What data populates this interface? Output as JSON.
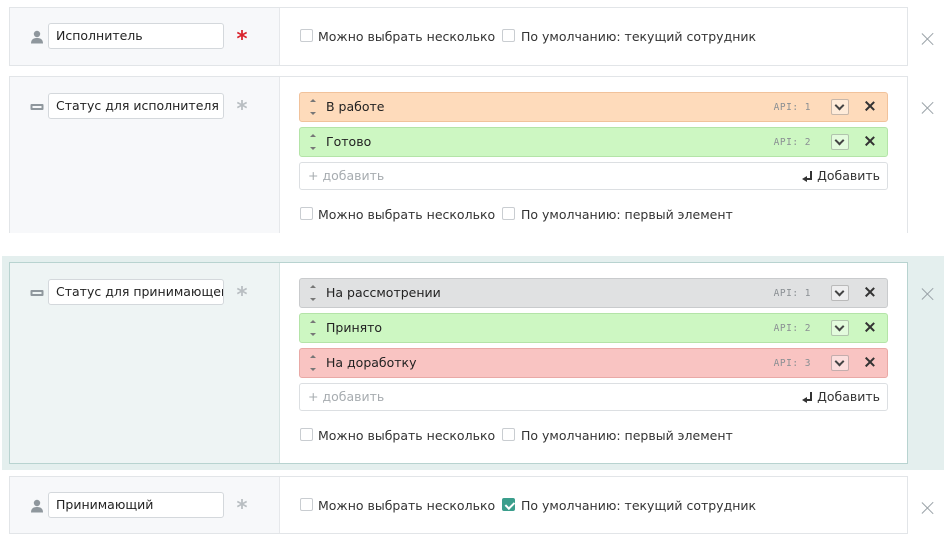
{
  "fields": [
    {
      "name": "Исполнитель",
      "icon": "user-icon",
      "required": true,
      "multiple_label": "Можно выбрать несколько",
      "default_label": "По умолчанию: текущий сотрудник",
      "default_checked": false
    },
    {
      "name": "Статус для исполнителя",
      "icon": "list-type-icon",
      "required": false,
      "options": [
        {
          "label": "В работе",
          "api": "API: 1",
          "color": "#fedbbb"
        },
        {
          "label": "Готово",
          "api": "API: 2",
          "color": "#cdf7c2"
        }
      ],
      "add_placeholder": "+ добавить",
      "add_button": "Добавить",
      "multiple_label": "Можно выбрать несколько",
      "default_label": "По умолчанию: первый элемент"
    },
    {
      "name": "Статус для принимающего",
      "icon": "list-type-icon",
      "required": false,
      "options": [
        {
          "label": "На рассмотрении",
          "api": "API: 1",
          "color": "#e0e1e2"
        },
        {
          "label": "Принято",
          "api": "API: 2",
          "color": "#cdf7c2"
        },
        {
          "label": "На доработку",
          "api": "API: 3",
          "color": "#f9c4c2"
        }
      ],
      "add_placeholder": "+ добавить",
      "add_button": "Добавить",
      "multiple_label": "Можно выбрать несколько",
      "default_label": "По умолчанию: первый элемент"
    },
    {
      "name": "Принимающий",
      "icon": "user-icon",
      "required": false,
      "multiple_label": "Можно выбрать несколько",
      "default_label": "По умолчанию: текущий сотрудник",
      "default_checked": true
    }
  ],
  "colors": {
    "accent": "#3b9e8c",
    "required": "#d9232d",
    "highlight": "#e4efee"
  }
}
